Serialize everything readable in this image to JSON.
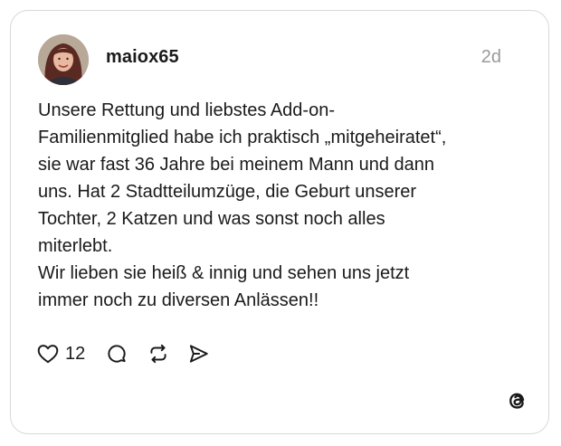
{
  "post": {
    "username": "maiox65",
    "time": "2d",
    "lines": [
      "Unsere Rettung und liebstes Add-on-",
      "Familienmitglied habe ich praktisch „mitgeheiratet“,",
      "sie war fast 36 Jahre bei meinem Mann und dann",
      "uns. Hat 2 Stadtteilumzüge, die Geburt unserer",
      "Tochter, 2 Katzen und was sonst noch alles",
      "miterlebt.",
      "Wir lieben sie heiß & innig und sehen uns jetzt",
      "immer noch zu diversen Anlässen!!"
    ]
  },
  "actions": {
    "like_count": "12",
    "icons": [
      "heart-icon",
      "comment-icon",
      "repost-icon",
      "share-icon"
    ]
  },
  "branding": {
    "logo": "threads-logo"
  },
  "colors": {
    "text": "#1a1a1a",
    "muted": "#9a9a9a",
    "border": "#d9d9d9"
  }
}
